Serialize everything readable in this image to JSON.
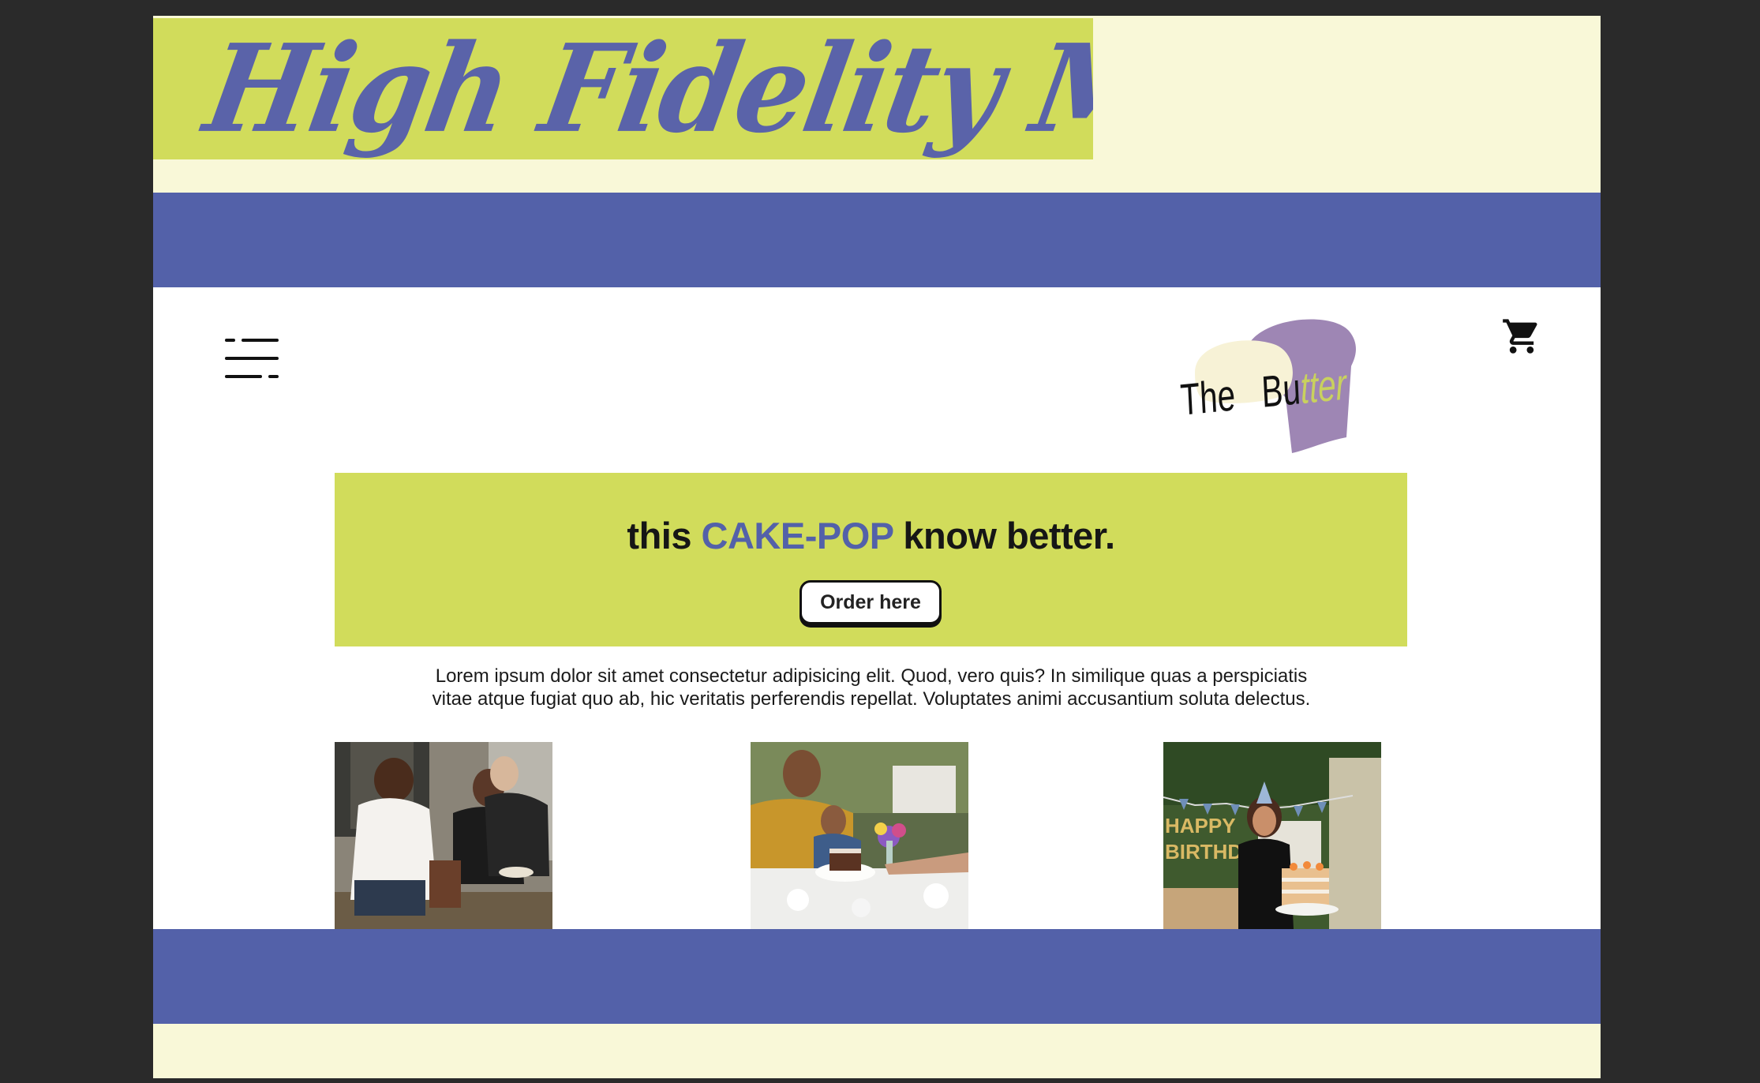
{
  "mockup_title": "High Fidelity Mock-up",
  "colors": {
    "background_outer": "#2a2a2a",
    "canvas": "#f9f8d8",
    "lime": "#d1dc5b",
    "indigo": "#5361a9",
    "logo_purple": "#9e86b4"
  },
  "header": {
    "menu_icon": "menu-icon",
    "cart_icon": "cart-icon",
    "logo": {
      "word_a": "The",
      "word_b": "Bu",
      "word_c": "tter"
    }
  },
  "hero": {
    "title_pre": "this ",
    "title_accent": "CAKE-POP",
    "title_post": " know better.",
    "button_label": "Order here"
  },
  "intro": {
    "text": "Lorem ipsum dolor sit amet consectetur adipisicing elit. Quod, vero quis? In similique quas a perspiciatis vitae atque fugiat quo ab, hic veritatis perferendis repellat. Voluptates animi accusantium soluta delectus."
  },
  "photos": [
    {
      "subject": "friends-laughing-photo"
    },
    {
      "subject": "dinner-cake-photo"
    },
    {
      "subject": "birthday-cake-photo",
      "banner_text": "HAPPY BIRTHDAY"
    }
  ]
}
